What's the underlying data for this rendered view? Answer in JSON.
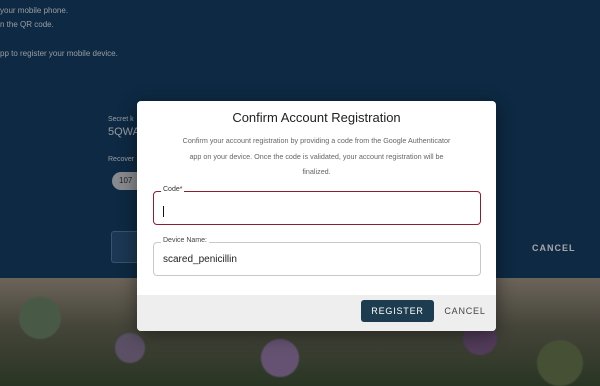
{
  "background": {
    "line1": "your mobile phone.",
    "line2": "n the QR code.",
    "line3": "pp to register your mobile device.",
    "secret_key_label": "Secret k",
    "secret_key_value": "5QWA",
    "recovery_label": "Recover",
    "recovery_chip": "107",
    "cancel_label": "CANCEL"
  },
  "dialog": {
    "title": "Confirm Account Registration",
    "description_line1": "Confirm your account registration by providing a code from the Google Authenticator",
    "description_line2": "app on your device. Once the code is validated, your account registration will be",
    "description_line3": "finalized.",
    "code_field": {
      "label": "Code*",
      "value": ""
    },
    "device_field": {
      "label": "Device Name:",
      "value": "scared_penicillin"
    },
    "register_label": "REGISTER",
    "cancel_label": "CANCEL"
  }
}
